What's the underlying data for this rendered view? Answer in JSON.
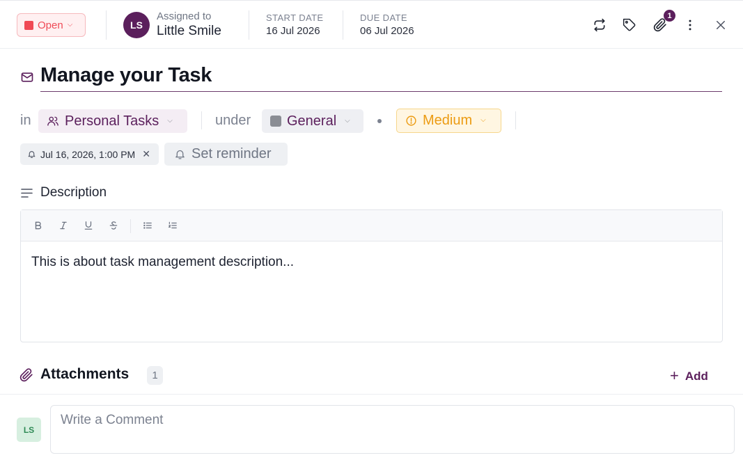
{
  "header": {
    "status_label": "Open",
    "status_color": "#f04a55",
    "assignee_initials": "LS",
    "assigned_caption": "Assigned to",
    "assignee_name": "Little Smile",
    "start_date_label": "START DATE",
    "start_date_value": "16 Jul 2026",
    "due_date_label": "DUE DATE",
    "due_date_value": "06 Jul 2026",
    "attachment_badge": "1",
    "icons": [
      "repeat-icon",
      "tag-icon",
      "paperclip-icon",
      "more-vertical-icon",
      "close-icon"
    ]
  },
  "task": {
    "title": "Manage your Task",
    "in_label": "in",
    "project": "Personal Tasks",
    "under_label": "under",
    "category": "General",
    "priority": "Medium",
    "reminder": "Jul 16, 2026, 1:00 PM",
    "set_reminder_label": "Set reminder"
  },
  "description": {
    "heading": "Description",
    "toolbar": [
      "bold",
      "italic",
      "underline",
      "strikethrough",
      "bullet-list",
      "numbered-list"
    ],
    "text": "This is about task management description..."
  },
  "attachments": {
    "heading": "Attachments",
    "count": "1",
    "add_label": "Add"
  },
  "comment": {
    "avatar_initials": "LS",
    "placeholder": "Write a Comment"
  },
  "colors": {
    "brand": "#5b1f5c",
    "priority": "#ec9b12",
    "status": "#ef4b57"
  }
}
